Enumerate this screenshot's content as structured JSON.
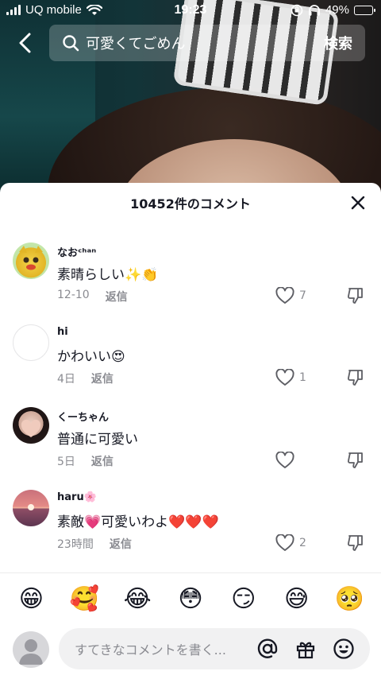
{
  "status_bar": {
    "carrier": "UQ mobile",
    "time": "19:23",
    "battery": "49%",
    "battery_level": 0.49
  },
  "search": {
    "query": "可愛くてごめん",
    "submit_label": "検索"
  },
  "comments_sheet": {
    "title": "10452件のコメント",
    "reply_label": "返信",
    "comments": [
      {
        "username": "なおᶜʰᵃⁿ",
        "text": "素晴らしい✨👏",
        "date": "12-10",
        "likes": "7",
        "avatar": "yellow-character-avatar"
      },
      {
        "username": "hi",
        "text": "かわいい😍",
        "date": "4日",
        "likes": "1",
        "avatar": "blank-avatar"
      },
      {
        "username": "くーちゃん",
        "text": "普通に可愛い",
        "date": "5日",
        "likes": "",
        "avatar": "girl-heart-hands-avatar"
      },
      {
        "username": "haru🌸",
        "text": "素敵💗可愛いわよ❤️❤️❤️",
        "date": "23時間",
        "likes": "2",
        "avatar": "sunset-avatar"
      }
    ]
  },
  "emoji_bar": [
    "😁",
    "🥰",
    "😂",
    "😳",
    "😏",
    "😅",
    "🥺"
  ],
  "comment_input": {
    "placeholder": "すてきなコメントを書く..."
  }
}
